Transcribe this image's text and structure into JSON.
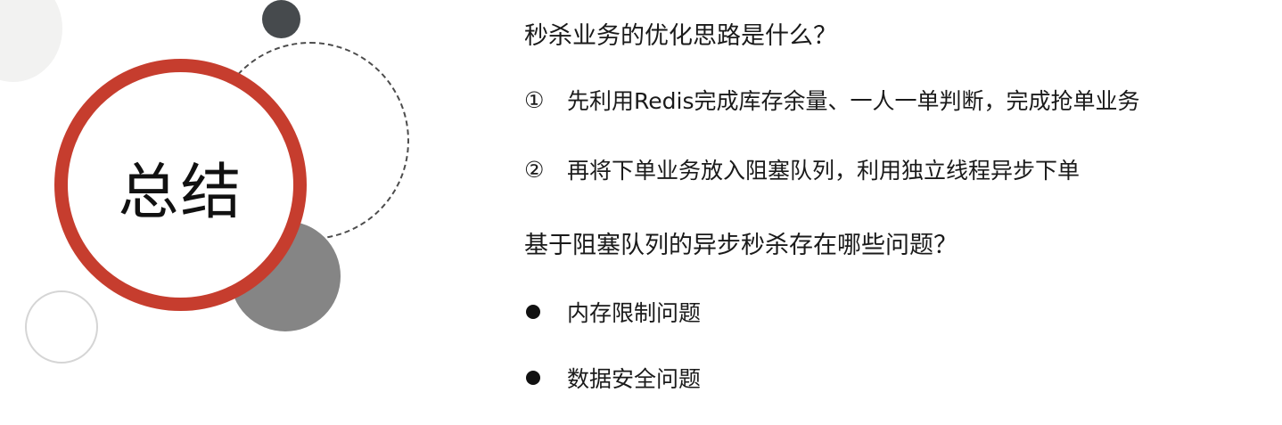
{
  "slide": {
    "title": "总结",
    "section1": {
      "question": "秒杀业务的优化思路是什么？",
      "items": [
        {
          "marker": "①",
          "text": "先利用Redis完成库存余量、一人一单判断，完成抢单业务"
        },
        {
          "marker": "②",
          "text": "再将下单业务放入阻塞队列，利用独立线程异步下单"
        }
      ]
    },
    "section2": {
      "question": "基于阻塞队列的异步秒杀存在哪些问题？",
      "items": [
        {
          "text": "内存限制问题"
        },
        {
          "text": "数据安全问题"
        }
      ]
    }
  },
  "colors": {
    "accent_red": "#c63d2e",
    "dark_gray": "#464a4d",
    "mid_gray": "#858585"
  }
}
